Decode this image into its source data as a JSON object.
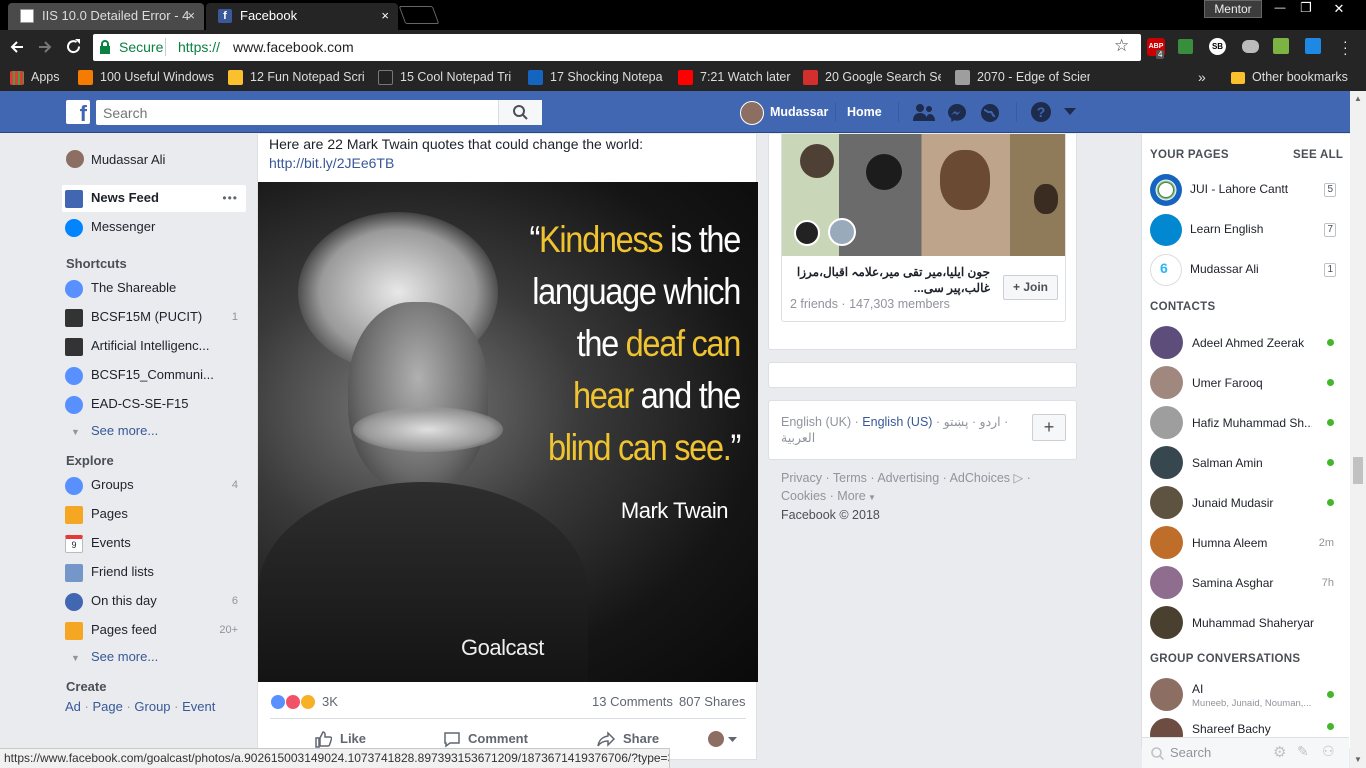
{
  "tabs": [
    {
      "title": "IIS 10.0 Detailed Error - 4",
      "close": "×"
    },
    {
      "title": "Facebook",
      "close": "×"
    }
  ],
  "window": {
    "profile": "Mentor",
    "minimize": "—",
    "restore": "❐",
    "close": "✕"
  },
  "toolbar": {
    "secure_label": "Secure",
    "url_scheme": "https://",
    "url_host": "www.facebook.com",
    "abp_count": "4"
  },
  "bookmarks": {
    "apps": "Apps",
    "items": [
      {
        "label": "100 Useful Windows",
        "color": "#f57c00"
      },
      {
        "label": "12 Fun Notepad Scri",
        "color": "#fbc02d"
      },
      {
        "label": "15 Cool Notepad Tri",
        "color": "#222222"
      },
      {
        "label": "17 Shocking Notepa",
        "color": "#1565c0"
      },
      {
        "label": "7:21 Watch later",
        "color": "#ff0000"
      },
      {
        "label": "20 Google Search Se",
        "color": "#d32f2f"
      },
      {
        "label": "2070 - Edge of Scien",
        "color": "#9e9e9e"
      }
    ],
    "overflow": "»",
    "other": "Other bookmarks"
  },
  "fbbar": {
    "search_placeholder": "Search",
    "user": "Mudassar",
    "home": "Home"
  },
  "left_nav": {
    "profile": "Mudassar Ali",
    "news_feed": "News Feed",
    "news_feed_more": "•••",
    "messenger": "Messenger",
    "shortcuts_head": "Shortcuts",
    "shortcuts": [
      {
        "label": "The Shareable",
        "count": ""
      },
      {
        "label": "BCSF15M (PUCIT)",
        "count": "1"
      },
      {
        "label": "Artificial Intelligenc...",
        "count": ""
      },
      {
        "label": "BCSF15_Communi...",
        "count": ""
      },
      {
        "label": "EAD-CS-SE-F15",
        "count": ""
      }
    ],
    "see_more": "See more...",
    "explore_head": "Explore",
    "explore": [
      {
        "label": "Groups",
        "count": "4"
      },
      {
        "label": "Pages",
        "count": ""
      },
      {
        "label": "Events",
        "count": ""
      },
      {
        "label": "Friend lists",
        "count": ""
      },
      {
        "label": "On this day",
        "count": "6"
      },
      {
        "label": "Pages feed",
        "count": "20+"
      }
    ],
    "events_day": "9",
    "see_more2": "See more...",
    "create_head": "Create",
    "create_links": [
      "Ad",
      "Page",
      "Group",
      "Event"
    ]
  },
  "post": {
    "text": "Here are 22 Mark Twain quotes that could change the world:",
    "link": "http://bit.ly/2JEe6TB",
    "image": {
      "quote_open": "“",
      "quote_parts": [
        {
          "text": "Kindness",
          "hl": true
        },
        {
          "text": " is the",
          "hl": false
        },
        {
          "text": "language which",
          "hl": false
        },
        {
          "text": "the ",
          "hl": false
        },
        {
          "text": "deaf can",
          "hl": true
        },
        {
          "text": "hear",
          "hl": true
        },
        {
          "text": " and the",
          "hl": false
        },
        {
          "text": "blind can see.",
          "hl": true
        },
        {
          "text": "”",
          "hl": false
        }
      ],
      "author": "Mark Twain",
      "brand": "Goalcast"
    },
    "reaction_count": "3K",
    "comments": "13 Comments",
    "shares": "807 Shares",
    "actions": {
      "like": "Like",
      "comment": "Comment",
      "share": "Share"
    }
  },
  "group_card": {
    "name": "جون ایلیا،میر تقی میر،علامہ اقبال،مرزا غالب،پیر سی...",
    "friends": "2 friends",
    "members": "147,303 members",
    "join": "+ Join"
  },
  "languages": {
    "items": [
      "English (UK)",
      "English (US)",
      "اردو",
      "پښتو",
      "العربية"
    ],
    "add": "+"
  },
  "footer": {
    "links": [
      "Privacy",
      "Terms",
      "Advertising",
      "AdChoices",
      "Cookies",
      "More"
    ],
    "copyright": "Facebook © 2018"
  },
  "right_sidebar": {
    "your_pages": "YOUR PAGES",
    "see_all": "SEE ALL",
    "pages": [
      {
        "name": "JUI - Lahore Cantt",
        "badge": "5"
      },
      {
        "name": "Learn English",
        "badge": "7"
      },
      {
        "name": "Mudassar Ali",
        "badge": "1"
      }
    ],
    "contacts_head": "CONTACTS",
    "contacts": [
      {
        "name": "Adeel Ahmed Zeerak",
        "status": "online"
      },
      {
        "name": "Umer Farooq",
        "status": "online"
      },
      {
        "name": "Hafiz Muhammad Sh...",
        "status": "online"
      },
      {
        "name": "Salman Amin",
        "status": "online"
      },
      {
        "name": "Junaid Mudasir",
        "status": "online"
      },
      {
        "name": "Humna Aleem",
        "status": "2m"
      },
      {
        "name": "Samina Asghar",
        "status": "7h"
      },
      {
        "name": "Muhammad Shaheryar",
        "status": ""
      }
    ],
    "group_conv_head": "GROUP CONVERSATIONS",
    "group_convs": [
      {
        "name": "AI",
        "sub": "Muneeb, Junaid, Nouman,..."
      },
      {
        "name": "Shareef Bachy",
        "sub": ""
      }
    ],
    "chat_search": "Search"
  },
  "status_url": "https://www.facebook.com/goalcast/photos/a.902615003149024.1073741828.897393153671209/1873671419376706/?type=3",
  "colors": {
    "fb_blue": "#4267b2",
    "link": "#385898",
    "online": "#42b72a",
    "quote_yellow": "#f0c330"
  }
}
